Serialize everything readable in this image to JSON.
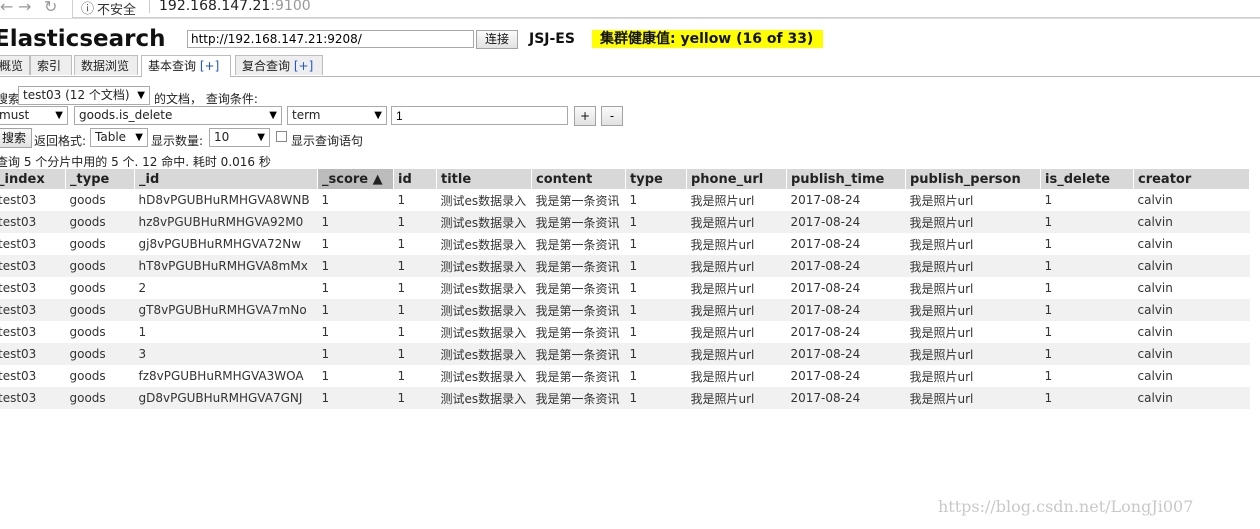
{
  "browser": {
    "back_icon": "←",
    "forward_icon": "→",
    "reload_icon": "↻",
    "info_icon": "ⓘ",
    "insecure_label": "不安全",
    "url_host": "192.168.147.21",
    "url_port": ":9100"
  },
  "header": {
    "title": "Elasticsearch",
    "connect_url": "http://192.168.147.21:9208/",
    "connect_label": "连接",
    "cluster_name": "JSJ-ES",
    "health_text": "集群健康值: yellow (16 of 33)",
    "health_color": "#ffff00"
  },
  "tabs": [
    {
      "label": "概览",
      "plus": ""
    },
    {
      "label": "索引",
      "plus": ""
    },
    {
      "label": "数据浏览",
      "plus": ""
    },
    {
      "label": "基本查询",
      "plus": "[+]"
    },
    {
      "label": "复合查询",
      "plus": "[+]"
    }
  ],
  "query": {
    "search_label": "搜索",
    "index_select": "test03 (12 个文档)",
    "docs_label": "的文档， 查询条件:",
    "bool_select": "must",
    "field_select": "goods.is_delete",
    "op_select": "term",
    "value": "1",
    "add_btn": "+",
    "remove_btn": "-",
    "search_btn": "搜索",
    "format_label": "返回格式:",
    "format_select": "Table",
    "size_label": "显示数量:",
    "size_select": "10",
    "show_query_label": "显示查询语句",
    "summary": "查询 5 个分片中用的 5 个. 12 命中. 耗时 0.016 秒"
  },
  "table": {
    "columns": [
      "_index",
      "_type",
      "_id",
      "_score ▲",
      "id",
      "title",
      "content",
      "type",
      "phone_url",
      "publish_time",
      "publish_person",
      "is_delete",
      "creator"
    ],
    "rows": [
      [
        "test03",
        "goods",
        "hD8vPGUBHuRMHGVA8WNB",
        "1",
        "1",
        "测试es数据录入",
        "我是第一条资讯",
        "1",
        "我是照片url",
        "2017-08-24",
        "我是照片url",
        "1",
        "calvin"
      ],
      [
        "test03",
        "goods",
        "hz8vPGUBHuRMHGVA92M0",
        "1",
        "1",
        "测试es数据录入",
        "我是第一条资讯",
        "1",
        "我是照片url",
        "2017-08-24",
        "我是照片url",
        "1",
        "calvin"
      ],
      [
        "test03",
        "goods",
        "gj8vPGUBHuRMHGVA72Nw",
        "1",
        "1",
        "测试es数据录入",
        "我是第一条资讯",
        "1",
        "我是照片url",
        "2017-08-24",
        "我是照片url",
        "1",
        "calvin"
      ],
      [
        "test03",
        "goods",
        "hT8vPGUBHuRMHGVA8mMx",
        "1",
        "1",
        "测试es数据录入",
        "我是第一条资讯",
        "1",
        "我是照片url",
        "2017-08-24",
        "我是照片url",
        "1",
        "calvin"
      ],
      [
        "test03",
        "goods",
        "2",
        "1",
        "1",
        "测试es数据录入",
        "我是第一条资讯",
        "1",
        "我是照片url",
        "2017-08-24",
        "我是照片url",
        "1",
        "calvin"
      ],
      [
        "test03",
        "goods",
        "gT8vPGUBHuRMHGVA7mNo",
        "1",
        "1",
        "测试es数据录入",
        "我是第一条资讯",
        "1",
        "我是照片url",
        "2017-08-24",
        "我是照片url",
        "1",
        "calvin"
      ],
      [
        "test03",
        "goods",
        "1",
        "1",
        "1",
        "测试es数据录入",
        "我是第一条资讯",
        "1",
        "我是照片url",
        "2017-08-24",
        "我是照片url",
        "1",
        "calvin"
      ],
      [
        "test03",
        "goods",
        "3",
        "1",
        "1",
        "测试es数据录入",
        "我是第一条资讯",
        "1",
        "我是照片url",
        "2017-08-24",
        "我是照片url",
        "1",
        "calvin"
      ],
      [
        "test03",
        "goods",
        "fz8vPGUBHuRMHGVA3WOA",
        "1",
        "1",
        "测试es数据录入",
        "我是第一条资讯",
        "1",
        "我是照片url",
        "2017-08-24",
        "我是照片url",
        "1",
        "calvin"
      ],
      [
        "test03",
        "goods",
        "gD8vPGUBHuRMHGVA7GNJ",
        "1",
        "1",
        "测试es数据录入",
        "我是第一条资讯",
        "1",
        "我是照片url",
        "2017-08-24",
        "我是照片url",
        "1",
        "calvin"
      ]
    ]
  },
  "watermark": "https://blog.csdn.net/LongJi007"
}
